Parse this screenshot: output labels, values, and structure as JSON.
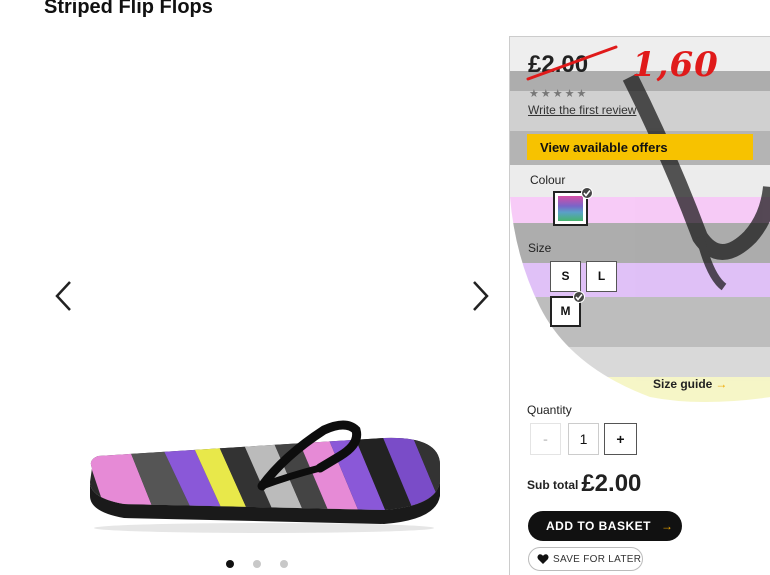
{
  "product": {
    "title": "Striped Flip Flops"
  },
  "gallery": {
    "prev_icon": "chevron-left-icon",
    "next_icon": "chevron-right-icon",
    "image_icon": "flip-flop-image",
    "dot_count": 3,
    "active_dot": 1
  },
  "pricing": {
    "old_price": "£2.00",
    "new_price": "1,60",
    "rating_stars": 0,
    "rating_max": 5,
    "review_link": "Write the first review"
  },
  "offers": {
    "label": "View available offers",
    "color": "#f7c200"
  },
  "colour": {
    "label": "Colour",
    "selected": "multi-stripe"
  },
  "size": {
    "label": "Size",
    "options": [
      "S",
      "L",
      "M"
    ],
    "selected": "M",
    "guide_label": "Size guide",
    "guide_arrow": "→"
  },
  "quantity": {
    "label": "Quantity",
    "minus": "-",
    "value": "1",
    "plus": "+"
  },
  "subtotal": {
    "label": "Sub total",
    "value": "£2.00"
  },
  "actions": {
    "add_to_basket": "ADD TO BASKET",
    "add_arrow": "→",
    "save_for_later": "SAVE FOR LATER"
  },
  "colors": {
    "strike": "#e01a1a",
    "accent": "#f7c200",
    "button": "#111111"
  }
}
